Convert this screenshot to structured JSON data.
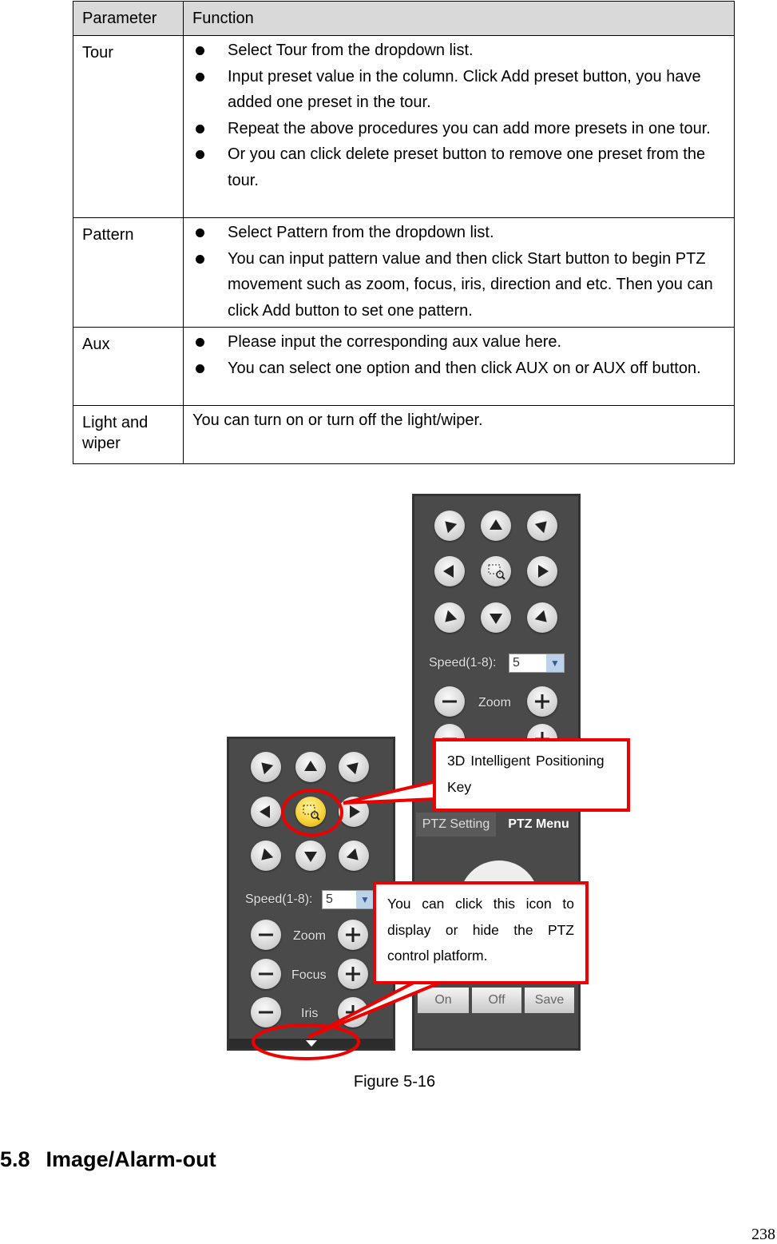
{
  "table": {
    "headers": [
      "Parameter",
      "Function"
    ],
    "rows": [
      {
        "parameter": "Tour",
        "bullets": [
          "Select Tour from the dropdown list.",
          "Input preset value in the column. Click Add preset button, you have added one preset in the tour.",
          "Repeat the above procedures you can add more presets in one tour.",
          "Or you can click delete preset button to remove one preset from the tour."
        ]
      },
      {
        "parameter": "Pattern",
        "bullets": [
          "Select Pattern from the dropdown list.",
          "You can input pattern value and then click Start button to begin PTZ movement such as zoom, focus, iris, direction and etc. Then you can click Add button to set one pattern."
        ]
      },
      {
        "parameter": "Aux",
        "bullets": [
          "Please input the corresponding aux value here.",
          "You can select one option and then click AUX on or AUX off button."
        ]
      },
      {
        "parameter": "Light and wiper",
        "text": "You can turn on or turn off the light/wiper."
      }
    ]
  },
  "figure": {
    "right_panel": {
      "speed_label": "Speed(1-8):",
      "speed_value": "5",
      "zoom_label": "Zoom",
      "tabs": [
        "PTZ Setting",
        "PTZ Menu"
      ],
      "buttons": [
        "On",
        "Off",
        "Save"
      ]
    },
    "left_panel": {
      "speed_label": "Speed(1-8):",
      "speed_value": "5",
      "zoom_label": "Zoom",
      "focus_label": "Focus",
      "iris_label": "Iris"
    },
    "callout_3d": "3D Intelligent Positioning Key",
    "callout_toggle": "You can click this icon to display or hide the PTZ control platform.",
    "highlight_color": "#f5d033",
    "callout_color": "#e00000",
    "caption": "Figure 5-16"
  },
  "section": {
    "number": "5.8",
    "title": "Image/Alarm-out"
  },
  "page_number": "238"
}
